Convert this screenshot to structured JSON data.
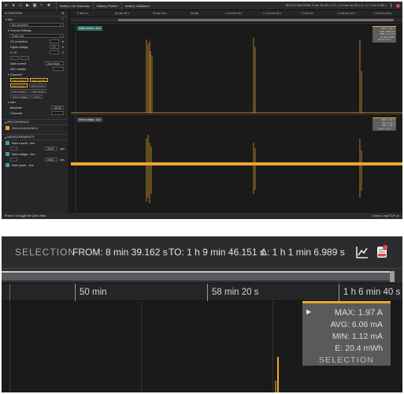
{
  "app": {
    "tabs": [
      "Battery Life Estimator",
      "Battery Profiler",
      "Battery Validation"
    ],
    "selection_summary": "SELECTION FROM: 8 min 39.162 s  TO: 1 h 9 min 46.151 s  Δ: 1 h 1 min 6.989 s"
  },
  "sidebar": {
    "control_header": "CONTROL",
    "device_label": "Ace",
    "device_status": "Not connected",
    "general_settings": "General Settings",
    "power_mode": "Power Out",
    "oc_protection": "OC protection",
    "oc_unit": "A",
    "digital_voltage": "Digital voltage",
    "digital_voltage_value": "3.3",
    "digital_voltage_unit": "V",
    "d_io": "D. IO",
    "d_io_unit": "V",
    "main_current": "Main current",
    "main_current_range": "Auto range",
    "adc_resistor": "ADC resistor",
    "channels": "Channels",
    "ch_buttons": [
      "Main current",
      "Main voltage",
      "Main power",
      "ADC current",
      "ADC voltage",
      "ADC power",
      "Sense voltage",
      "GPIO"
    ],
    "uart": "Uart",
    "baudrate": "Baudrate",
    "baudrate_value": "115200",
    "channels_label": "Channels",
    "recordings_header": "RECORDINGS",
    "recording_date": "2024-10-08 09:08:11",
    "measurements_header": "MEASUREMENTS",
    "m1_label": "Main current - Ace",
    "m1_rate": "50000",
    "m1_unit": "sps",
    "m2_label": "Main voltage - Ace",
    "m2_rate": "50000",
    "m2_unit": "sps",
    "m3_label": "Main power - Ace"
  },
  "overview": {
    "axis_ticks": [
      "0 min 0 s",
      "16 min 40 s",
      "33 min 20 s",
      "50 min",
      "1 h 6 min 40 s",
      "1 h 23 min 20 s",
      "1 h 40 min",
      "1 h 56 min 40 s",
      "2 h 13 min 20 s"
    ],
    "chart1_title": "Main current - Ace",
    "chart1_stats": [
      "MAX: 1.97 A",
      "AVG: 6.06 mA",
      "MIN: 1.12 mA",
      "E: 20.4 mWh",
      "SELECTION"
    ],
    "chart2_title": "Main voltage - Ace",
    "chart2_stats": [
      "MAX: 3.33 V",
      "AVG: 3.30 V",
      "MIN: 3.28 V",
      "SELECTION"
    ],
    "status_left": "Press H to toggle the Quick Help.",
    "status_right": "Cursor: Long   TCP: on"
  },
  "zoom": {
    "selection_label": "SELECTION",
    "from": "FROM: 8 min 39.162 s",
    "to": "TO: 1 h 9 min 46.151 s",
    "delta": "Δ: 1 h 1 min 6.989 s",
    "ticks": [
      "50 min",
      "58 min 20 s",
      "1 h 6 min 40 s"
    ],
    "stats": {
      "max": "MAX:  1.97 A",
      "avg": "AVG:  6.06 mA",
      "min": "MIN:  1.12 mA",
      "energy": "E:  20.4 mWh",
      "selection": "SELECTION"
    },
    "accent_color": "#e8a831"
  }
}
